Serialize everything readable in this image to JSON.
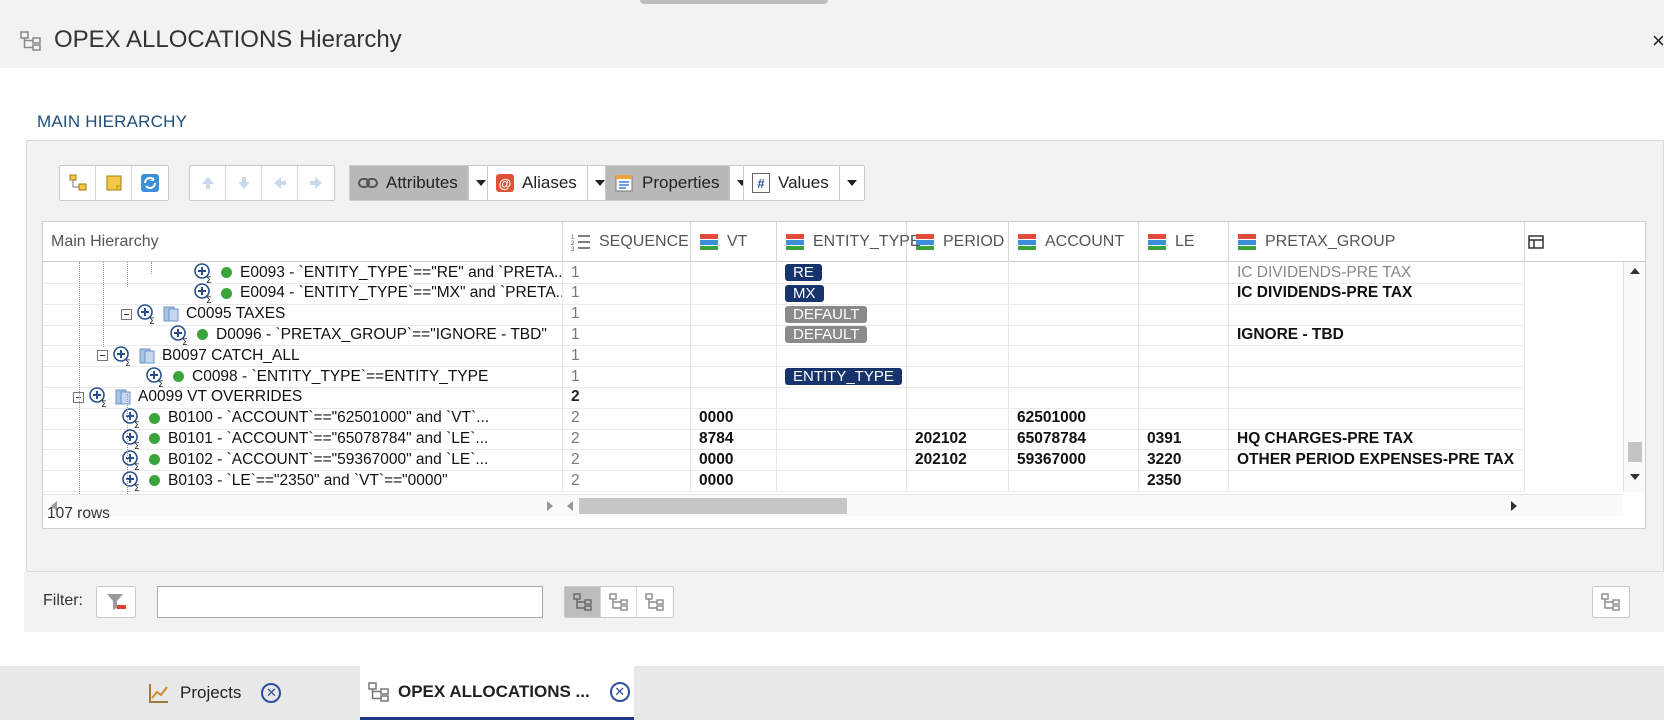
{
  "window": {
    "title": "OPEX ALLOCATIONS Hierarchy",
    "close_glyph": "×",
    "title_icon": "hierarchy-icon"
  },
  "section": {
    "label": "MAIN HIERARCHY"
  },
  "toolbar": {
    "attributes_label": "Attributes",
    "aliases_label": "Aliases",
    "properties_label": "Properties",
    "values_label": "Values",
    "aliases_glyph": "@",
    "values_glyph": "#"
  },
  "grid": {
    "columns": [
      "Main Hierarchy",
      "SEQUENCE",
      "VT",
      "ENTITY_TYPE",
      "PERIOD",
      "ACCOUNT",
      "LE",
      "PRETAX_GROUP"
    ],
    "rows": [
      {
        "node": "E0093 - `ENTITY_TYPE`==\"RE\" and `PRETA...",
        "seq": "1",
        "vt": "",
        "entity_type": "RE",
        "period": "",
        "account": "",
        "le": "",
        "pretax": "IC DIVIDENDS-PRE TAX"
      },
      {
        "node": "E0094 - `ENTITY_TYPE`==\"MX\" and `PRETA...",
        "seq": "1",
        "vt": "",
        "entity_type": "MX",
        "period": "",
        "account": "",
        "le": "",
        "pretax": "IC DIVIDENDS-PRE TAX"
      },
      {
        "node": "C0095 TAXES",
        "seq": "1",
        "vt": "",
        "entity_type": "DEFAULT",
        "period": "",
        "account": "",
        "le": "",
        "pretax": ""
      },
      {
        "node": "D0096 - `PRETAX_GROUP`==\"IGNORE - TBD\"",
        "seq": "1",
        "vt": "",
        "entity_type": "DEFAULT",
        "period": "",
        "account": "",
        "le": "",
        "pretax": "IGNORE - TBD"
      },
      {
        "node": "B0097 CATCH_ALL",
        "seq": "1",
        "vt": "",
        "entity_type": "",
        "period": "",
        "account": "",
        "le": "",
        "pretax": ""
      },
      {
        "node": "C0098 - `ENTITY_TYPE`==ENTITY_TYPE",
        "seq": "1",
        "vt": "",
        "entity_type": "ENTITY_TYPE",
        "period": "",
        "account": "",
        "le": "",
        "pretax": ""
      },
      {
        "node": "A0099 VT OVERRIDES",
        "seq": "2",
        "vt": "",
        "entity_type": "",
        "period": "",
        "account": "",
        "le": "",
        "pretax": ""
      },
      {
        "node": "B0100 - `ACCOUNT`==\"62501000\" and `VT`...",
        "seq": "2",
        "vt": "0000",
        "entity_type": "",
        "period": "",
        "account": "62501000",
        "le": "",
        "pretax": ""
      },
      {
        "node": "B0101 - `ACCOUNT`==\"65078784\" and `LE`...",
        "seq": "2",
        "vt": "8784",
        "entity_type": "",
        "period": "202102",
        "account": "65078784",
        "le": "0391",
        "pretax": "HQ CHARGES-PRE TAX"
      },
      {
        "node": "B0102 - `ACCOUNT`==\"59367000\" and `LE`...",
        "seq": "2",
        "vt": "0000",
        "entity_type": "",
        "period": "202102",
        "account": "59367000",
        "le": "3220",
        "pretax": "OTHER PERIOD EXPENSES-PRE TAX"
      },
      {
        "node": "B0103 - `LE`==\"2350\" and `VT`==\"0000\"",
        "seq": "2",
        "vt": "0000",
        "entity_type": "",
        "period": "",
        "account": "",
        "le": "2350",
        "pretax": ""
      }
    ],
    "row_count": "107 rows"
  },
  "filter": {
    "label": "Filter:",
    "value": "",
    "placeholder": ""
  },
  "tabs": [
    {
      "label": "Projects"
    },
    {
      "label": "OPEX ALLOCATIONS ..."
    }
  ],
  "colors": {
    "accent": "#1f3a8a",
    "badge_blue": "#16336b",
    "badge_grey": "#8a8a8a",
    "node_green": "#3aa43a"
  }
}
